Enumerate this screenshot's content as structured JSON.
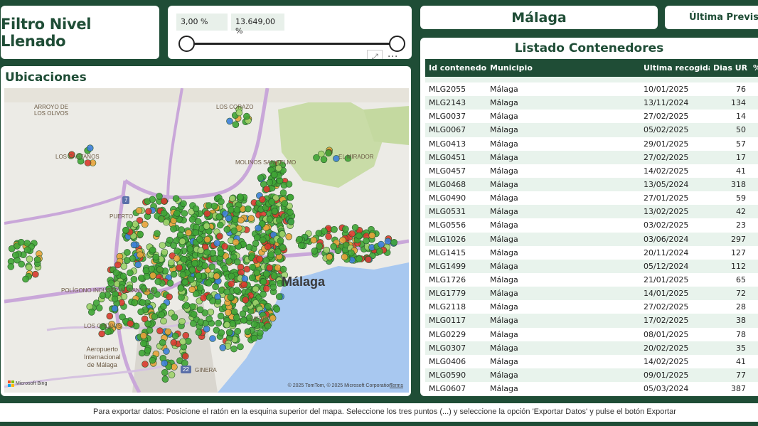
{
  "title_card": {
    "title": "Filtro Nivel Llenado"
  },
  "slider": {
    "min_value": "3,00 %",
    "max_value": "13.649,00 %",
    "expand_symbol": "⤢",
    "more_symbol": "···"
  },
  "city": {
    "name": "Málaga"
  },
  "forecast": {
    "label": "Última Previsión"
  },
  "map": {
    "title": "Ubicaciones",
    "labels": {
      "arroyo": "ARROYO DE\nLOS OLIVOS",
      "corazo": "LOS CORAZO",
      "castanos": "LOS CASTAÑOS",
      "molinos": "MOLINOS SAN TELMO",
      "mirador": "EL MIRADOR",
      "puerto": "PUERTO",
      "poligono": "POLÍGONO INDUSTRIAL SAN LUIS",
      "chopos": "LOS CHOPOS",
      "aeropuerto": "Aeropuerto\nInternacional\nde Málaga",
      "sierra": "SIERRA",
      "ginera": "GINERA",
      "city": "Málaga"
    },
    "road_badges": [
      "7",
      "22"
    ],
    "copyright": "© 2025 TomTom, © 2025 Microsoft Corporation",
    "terms": "Terms",
    "bing": "Microsoft Bing",
    "colors": {
      "green": "#3fa535",
      "light_green": "#9ed36a",
      "red": "#d83a2e",
      "orange": "#e8a33a",
      "blue": "#3d7fd9",
      "sea": "#a8c8f0"
    }
  },
  "table": {
    "title": "Listado Contenedores",
    "columns": [
      "Id contenedor",
      "Municipio",
      "Ultima recogida",
      "Dias UR",
      "%"
    ],
    "rows": [
      [
        "MLG2055",
        "Málaga",
        "10/01/2025",
        "76"
      ],
      [
        "MLG2143",
        "Málaga",
        "13/11/2024",
        "134"
      ],
      [
        "MLG0037",
        "Málaga",
        "27/02/2025",
        "14"
      ],
      [
        "MLG0067",
        "Málaga",
        "05/02/2025",
        "50"
      ],
      [
        "MLG0413",
        "Málaga",
        "29/01/2025",
        "57"
      ],
      [
        "MLG0451",
        "Málaga",
        "27/02/2025",
        "17"
      ],
      [
        "MLG0457",
        "Málaga",
        "14/02/2025",
        "41"
      ],
      [
        "MLG0468",
        "Málaga",
        "13/05/2024",
        "318"
      ],
      [
        "MLG0490",
        "Málaga",
        "27/01/2025",
        "59"
      ],
      [
        "MLG0531",
        "Málaga",
        "13/02/2025",
        "42"
      ],
      [
        "MLG0556",
        "Málaga",
        "03/02/2025",
        "23"
      ],
      [
        "MLG1026",
        "Málaga",
        "03/06/2024",
        "297"
      ],
      [
        "MLG1415",
        "Málaga",
        "20/11/2024",
        "127"
      ],
      [
        "MLG1499",
        "Málaga",
        "05/12/2024",
        "112"
      ],
      [
        "MLG1726",
        "Málaga",
        "21/01/2025",
        "65"
      ],
      [
        "MLG1779",
        "Málaga",
        "14/01/2025",
        "72"
      ],
      [
        "MLG2118",
        "Málaga",
        "27/02/2025",
        "28"
      ],
      [
        "MLG0117",
        "Málaga",
        "17/02/2025",
        "38"
      ],
      [
        "MLG0229",
        "Málaga",
        "08/01/2025",
        "78"
      ],
      [
        "MLG0307",
        "Málaga",
        "20/02/2025",
        "35"
      ],
      [
        "MLG0406",
        "Málaga",
        "14/02/2025",
        "41"
      ],
      [
        "MLG0590",
        "Málaga",
        "09/01/2025",
        "77"
      ],
      [
        "MLG0607",
        "Málaga",
        "05/03/2024",
        "387"
      ]
    ]
  },
  "footer": {
    "text": "Para exportar datos: Posicione el ratón en la esquina superior del mapa. Seleccione los tres puntos (...) y seleccione la opción 'Exportar Datos' y pulse el botón Exportar"
  }
}
